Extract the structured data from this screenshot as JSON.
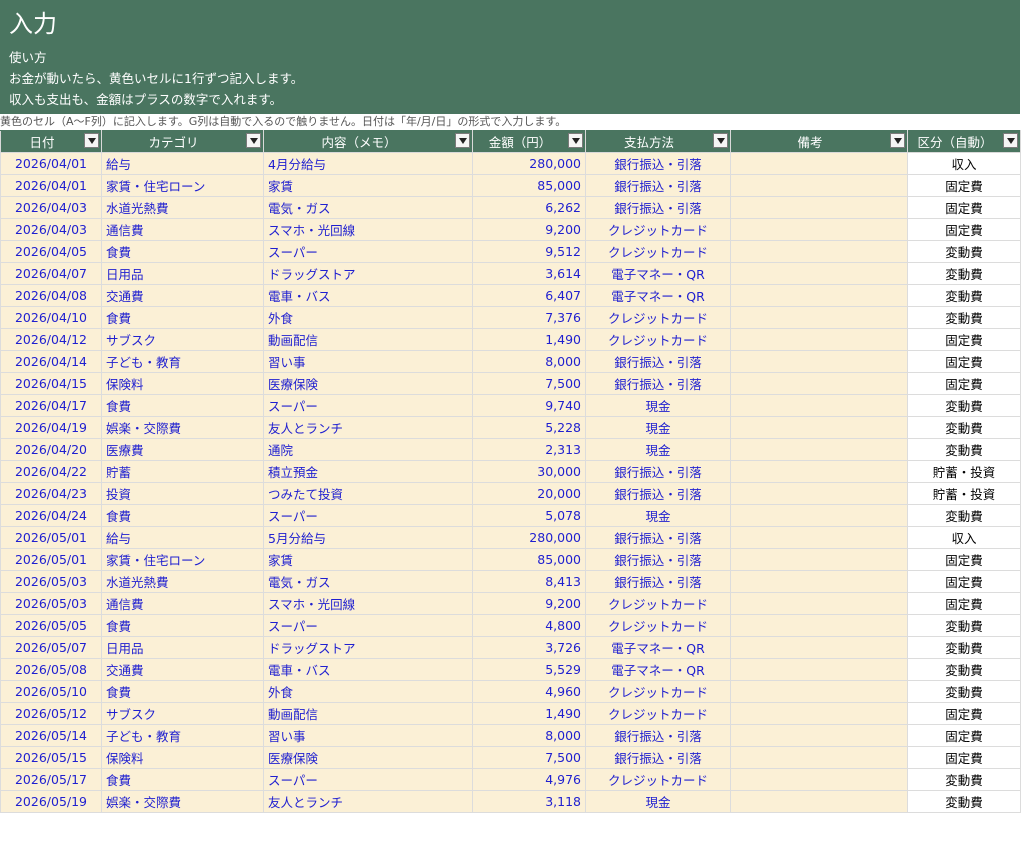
{
  "banner": {
    "title": "入力",
    "line1": "使い方",
    "line2": "お金が動いたら、黄色いセルに1行ずつ記入します。",
    "line3": "収入も支出も、金額はプラスの数字で入れます。"
  },
  "note": "黄色のセル（A〜F列）に記入します。G列は自動で入るので触りません。日付は「年/月/日」の形式で入力します。",
  "headers": [
    "日付",
    "カテゴリ",
    "内容（メモ）",
    "金額（円）",
    "支払方法",
    "備考",
    "区分（自動）"
  ],
  "rows": [
    [
      "2026/04/01",
      "給与",
      "4月分給与",
      "280,000",
      "銀行振込・引落",
      "",
      "収入"
    ],
    [
      "2026/04/01",
      "家賃・住宅ローン",
      "家賃",
      "85,000",
      "銀行振込・引落",
      "",
      "固定費"
    ],
    [
      "2026/04/03",
      "水道光熱費",
      "電気・ガス",
      "6,262",
      "銀行振込・引落",
      "",
      "固定費"
    ],
    [
      "2026/04/03",
      "通信費",
      "スマホ・光回線",
      "9,200",
      "クレジットカード",
      "",
      "固定費"
    ],
    [
      "2026/04/05",
      "食費",
      "スーパー",
      "9,512",
      "クレジットカード",
      "",
      "変動費"
    ],
    [
      "2026/04/07",
      "日用品",
      "ドラッグストア",
      "3,614",
      "電子マネー・QR",
      "",
      "変動費"
    ],
    [
      "2026/04/08",
      "交通費",
      "電車・バス",
      "6,407",
      "電子マネー・QR",
      "",
      "変動費"
    ],
    [
      "2026/04/10",
      "食費",
      "外食",
      "7,376",
      "クレジットカード",
      "",
      "変動費"
    ],
    [
      "2026/04/12",
      "サブスク",
      "動画配信",
      "1,490",
      "クレジットカード",
      "",
      "固定費"
    ],
    [
      "2026/04/14",
      "子ども・教育",
      "習い事",
      "8,000",
      "銀行振込・引落",
      "",
      "固定費"
    ],
    [
      "2026/04/15",
      "保険料",
      "医療保険",
      "7,500",
      "銀行振込・引落",
      "",
      "固定費"
    ],
    [
      "2026/04/17",
      "食費",
      "スーパー",
      "9,740",
      "現金",
      "",
      "変動費"
    ],
    [
      "2026/04/19",
      "娯楽・交際費",
      "友人とランチ",
      "5,228",
      "現金",
      "",
      "変動費"
    ],
    [
      "2026/04/20",
      "医療費",
      "通院",
      "2,313",
      "現金",
      "",
      "変動費"
    ],
    [
      "2026/04/22",
      "貯蓄",
      "積立預金",
      "30,000",
      "銀行振込・引落",
      "",
      "貯蓄・投資"
    ],
    [
      "2026/04/23",
      "投資",
      "つみたて投資",
      "20,000",
      "銀行振込・引落",
      "",
      "貯蓄・投資"
    ],
    [
      "2026/04/24",
      "食費",
      "スーパー",
      "5,078",
      "現金",
      "",
      "変動費"
    ],
    [
      "2026/05/01",
      "給与",
      "5月分給与",
      "280,000",
      "銀行振込・引落",
      "",
      "収入"
    ],
    [
      "2026/05/01",
      "家賃・住宅ローン",
      "家賃",
      "85,000",
      "銀行振込・引落",
      "",
      "固定費"
    ],
    [
      "2026/05/03",
      "水道光熱費",
      "電気・ガス",
      "8,413",
      "銀行振込・引落",
      "",
      "固定費"
    ],
    [
      "2026/05/03",
      "通信費",
      "スマホ・光回線",
      "9,200",
      "クレジットカード",
      "",
      "固定費"
    ],
    [
      "2026/05/05",
      "食費",
      "スーパー",
      "4,800",
      "クレジットカード",
      "",
      "変動費"
    ],
    [
      "2026/05/07",
      "日用品",
      "ドラッグストア",
      "3,726",
      "電子マネー・QR",
      "",
      "変動費"
    ],
    [
      "2026/05/08",
      "交通費",
      "電車・バス",
      "5,529",
      "電子マネー・QR",
      "",
      "変動費"
    ],
    [
      "2026/05/10",
      "食費",
      "外食",
      "4,960",
      "クレジットカード",
      "",
      "変動費"
    ],
    [
      "2026/05/12",
      "サブスク",
      "動画配信",
      "1,490",
      "クレジットカード",
      "",
      "固定費"
    ],
    [
      "2026/05/14",
      "子ども・教育",
      "習い事",
      "8,000",
      "銀行振込・引落",
      "",
      "固定費"
    ],
    [
      "2026/05/15",
      "保険料",
      "医療保険",
      "7,500",
      "銀行振込・引落",
      "",
      "固定費"
    ],
    [
      "2026/05/17",
      "食費",
      "スーパー",
      "4,976",
      "クレジットカード",
      "",
      "変動費"
    ],
    [
      "2026/05/19",
      "娯楽・交際費",
      "友人とランチ",
      "3,118",
      "現金",
      "",
      "変動費"
    ]
  ]
}
